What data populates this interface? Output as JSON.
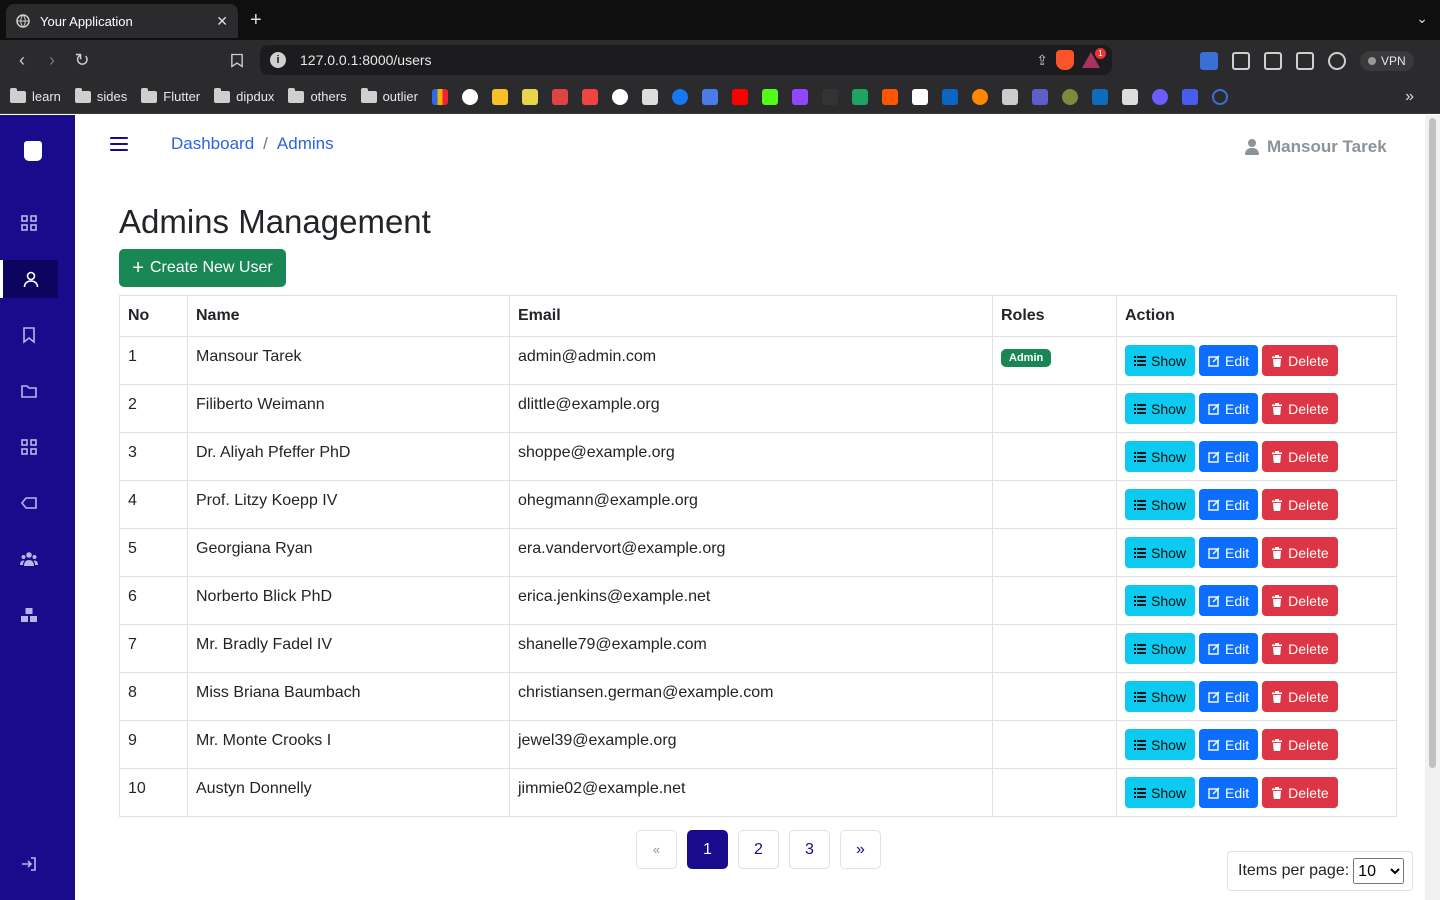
{
  "browser": {
    "tab_title": "Your Application",
    "tab_close": "✕",
    "new_tab": "+",
    "url": "127.0.0.1:8000/users",
    "vpn_label": "VPN",
    "notification_count": "1",
    "bookmarks": [
      "learn",
      "sides",
      "Flutter",
      "dipdux",
      "others",
      "outlier"
    ],
    "bookmark_more": "»"
  },
  "breadcrumb": {
    "items": [
      "Dashboard",
      "Admins"
    ],
    "separator": "/"
  },
  "user": {
    "name": "Mansour Tarek"
  },
  "page": {
    "title": "Admins Management",
    "create_button": "Create New User",
    "create_icon": "+"
  },
  "table": {
    "headers": [
      "No",
      "Name",
      "Email",
      "Roles",
      "Action"
    ],
    "rows": [
      {
        "no": "1",
        "name": "Mansour Tarek",
        "email": "admin@admin.com",
        "role": "Admin"
      },
      {
        "no": "2",
        "name": "Filiberto Weimann",
        "email": "dlittle@example.org",
        "role": ""
      },
      {
        "no": "3",
        "name": "Dr. Aliyah Pfeffer PhD",
        "email": "shoppe@example.org",
        "role": ""
      },
      {
        "no": "4",
        "name": "Prof. Litzy Koepp IV",
        "email": "ohegmann@example.org",
        "role": ""
      },
      {
        "no": "5",
        "name": "Georgiana Ryan",
        "email": "era.vandervort@example.org",
        "role": ""
      },
      {
        "no": "6",
        "name": "Norberto Blick PhD",
        "email": "erica.jenkins@example.net",
        "role": ""
      },
      {
        "no": "7",
        "name": "Mr. Bradly Fadel IV",
        "email": "shanelle79@example.com",
        "role": ""
      },
      {
        "no": "8",
        "name": "Miss Briana Baumbach",
        "email": "christiansen.german@example.com",
        "role": ""
      },
      {
        "no": "9",
        "name": "Mr. Monte Crooks I",
        "email": "jewel39@example.org",
        "role": ""
      },
      {
        "no": "10",
        "name": "Austyn Donnelly",
        "email": "jimmie02@example.net",
        "role": ""
      }
    ],
    "actions": {
      "show": "Show",
      "edit": "Edit",
      "delete": "Delete"
    }
  },
  "pagination": {
    "prev": "«",
    "pages": [
      "1",
      "2",
      "3"
    ],
    "current": "1",
    "next": "»"
  },
  "per_page": {
    "label": "Items per page:",
    "selected": "10"
  },
  "colors": {
    "sidebar": "#1a0a8c",
    "primary_link": "#2b63e3",
    "success": "#198754",
    "info": "#0dcaf0",
    "primary": "#0d6efd",
    "danger": "#dc3545"
  },
  "sidebar_icons": [
    "shopify-logo-icon",
    "grid-icon",
    "user-icon",
    "bookmark-icon",
    "folder-icon",
    "grid-icon",
    "tag-icon",
    "users-icon",
    "boxes-icon",
    "logout-icon"
  ]
}
